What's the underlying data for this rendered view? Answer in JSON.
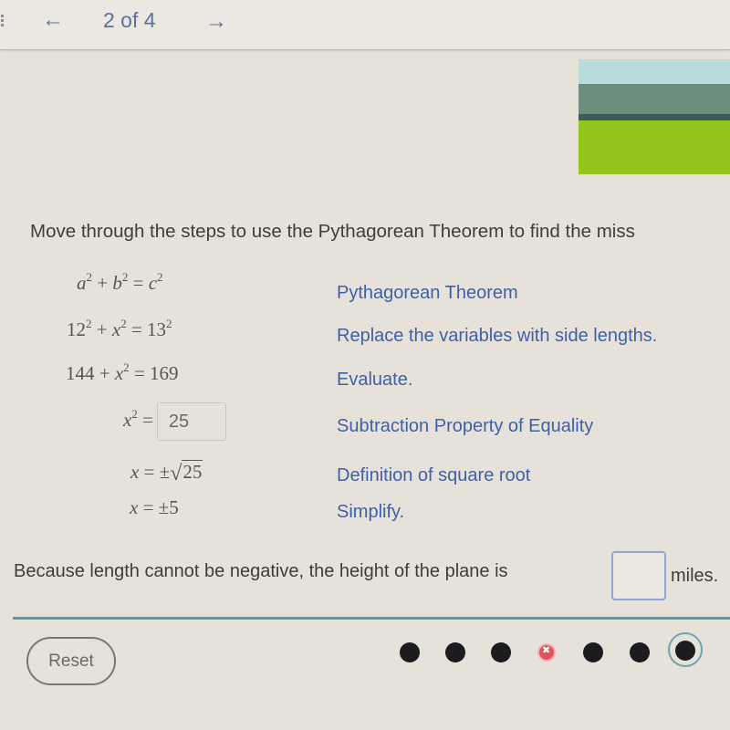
{
  "nav": {
    "prev_icon": "arrow-left-icon",
    "prev_glyph": "←",
    "position_label": "2 of 4",
    "next_icon": "arrow-right-icon",
    "next_glyph": "→",
    "menu_icon": "vertical-dots-icon"
  },
  "scene_image": {
    "description": "landscape illustration",
    "colors": {
      "sky": "#b6dcdc",
      "hill": "#6c8e7c",
      "road": "#3f5a5e",
      "grass": "#93c61a"
    }
  },
  "prompt": "Move through the steps to use the Pythagorean Theorem to find the miss",
  "steps": [
    {
      "equation": "a² + b² = c²",
      "reason": "Pythagorean Theorem"
    },
    {
      "equation": "12² + x² = 13²",
      "reason": "Replace the variables with side lengths."
    },
    {
      "equation": "144 + x² = 169",
      "reason": "Evaluate."
    },
    {
      "equation": "x² =",
      "answer_value": "25",
      "reason": "Subtraction Property of Equality"
    },
    {
      "equation": "x = ±√25",
      "radicand": "25",
      "reason": "Definition of square root"
    },
    {
      "equation": "x = ±5",
      "reason": "Simplify."
    }
  ],
  "conclusion": {
    "text": "Because length cannot be negative, the height of the plane is",
    "input_value": "",
    "unit": "miles."
  },
  "controls": {
    "reset_label": "Reset"
  },
  "progress": {
    "dots": [
      {
        "status": "complete"
      },
      {
        "status": "complete"
      },
      {
        "status": "complete"
      },
      {
        "status": "incorrect"
      },
      {
        "status": "complete"
      },
      {
        "status": "complete"
      },
      {
        "status": "current"
      }
    ],
    "colors": {
      "complete": "#1c1c1e",
      "incorrect": "#e0535a",
      "current_ring": "#6aa8b0"
    }
  },
  "colors": {
    "reason_text": "#3f60a8",
    "nav_text": "#5c6fa3",
    "divider": "#6d9496",
    "input_border": "#8fa5d8"
  }
}
